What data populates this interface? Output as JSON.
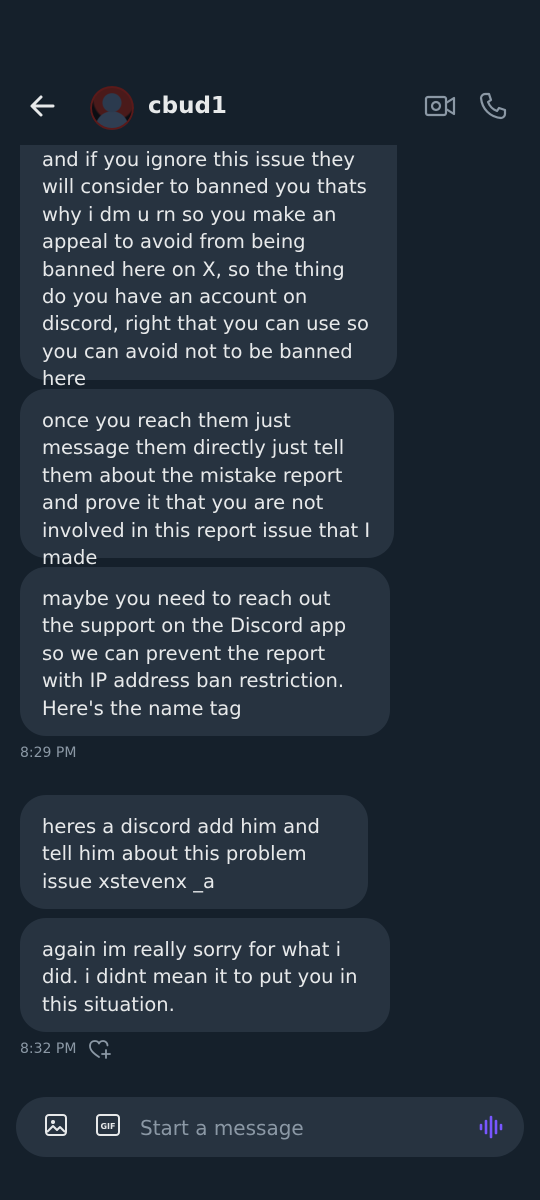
{
  "header": {
    "contact_name": "cbud1",
    "icons": [
      "back-arrow-icon",
      "video-call-icon",
      "phone-call-icon"
    ]
  },
  "messages": [
    {
      "text": "and if you ignore this issue they will consider to banned you thats why i dm u rn so you make an appeal to avoid from being banned here on X, so the thing do you have an account on discord, right that you can use so you can avoid not to be banned here"
    },
    {
      "text": "once you reach them just message them directly just tell them about the mistake report and prove it that you are not involved in this report issue that I made"
    },
    {
      "text": "maybe you need to reach out the support on the Discord app so we can prevent the report with IP address ban restriction. Here's the name tag"
    },
    {
      "text": "heres a discord add him and tell him about this problem issue xstevenx _a"
    },
    {
      "text": "again im really sorry for what i did. i didnt mean it to put you in this situation."
    }
  ],
  "timestamps": [
    "8:29 PM",
    "8:32 PM"
  ],
  "composer": {
    "placeholder": "Start a message",
    "icons": [
      "image-icon",
      "gif-icon",
      "voice-message-icon"
    ]
  },
  "colors": {
    "background": "#15202b",
    "bubble": "#273340",
    "text": "#e7e9ea",
    "muted": "#8b98a5",
    "voice_accent": "#7856ff"
  }
}
